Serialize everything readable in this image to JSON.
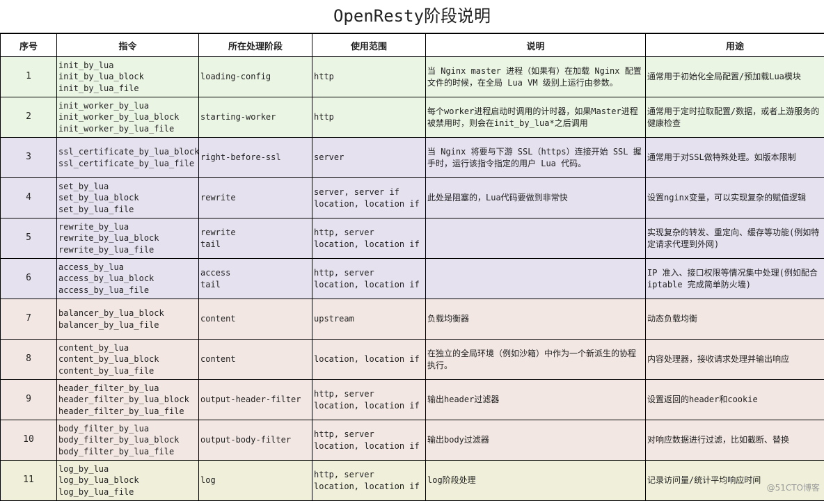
{
  "title": "OpenResty阶段说明",
  "headers": [
    "序号",
    "指令",
    "所在处理阶段",
    "使用范围",
    "说明",
    "用途"
  ],
  "rows": [
    {
      "no": "1",
      "directives": [
        "init_by_lua",
        "init_by_lua_block",
        "init_by_lua_file"
      ],
      "phase": [
        "loading-config"
      ],
      "scope": [
        "http"
      ],
      "desc": "当 Nginx master 进程（如果有）在加载 Nginx 配置文件的时候，在全局 Lua VM 级别上运行由参数。",
      "use": "通常用于初始化全局配置/预加载Lua模块"
    },
    {
      "no": "2",
      "directives": [
        "init_worker_by_lua",
        "init_worker_by_lua_block",
        "init_worker_by_lua_file"
      ],
      "phase": [
        "starting-worker"
      ],
      "scope": [
        "http"
      ],
      "desc": "每个worker进程启动时调用的计时器，如果Master进程被禁用时，则会在init_by_lua*之后调用",
      "use": "通常用于定时拉取配置/数据，或者上游服务的健康检查"
    },
    {
      "no": "3",
      "directives": [
        "ssl_certificate_by_lua_block",
        "ssl_certificate_by_lua_file"
      ],
      "phase": [
        "right-before-ssl"
      ],
      "scope": [
        "server"
      ],
      "desc": "当 Nginx 将要与下游 SSL（https）连接开始 SSL 握手时，运行该指令指定的用户 Lua 代码。",
      "use": "通常用于对SSL做特殊处理。如版本限制"
    },
    {
      "no": "4",
      "directives": [
        "set_by_lua",
        "set_by_lua_block",
        "set_by_lua_file"
      ],
      "phase": [
        "rewrite"
      ],
      "scope": [
        "server, server if",
        "location, location if"
      ],
      "desc": "此处是阻塞的，Lua代码要做到非常快",
      "use": "设置nginx变量，可以实现复杂的赋值逻辑"
    },
    {
      "no": "5",
      "directives": [
        "rewrite_by_lua",
        "rewrite_by_lua_block",
        "rewrite_by_lua_file"
      ],
      "phase": [
        "rewrite",
        "tail"
      ],
      "scope": [
        "http, server",
        "location, location if"
      ],
      "desc": "",
      "use": "实现复杂的转发、重定向、缓存等功能(例如特定请求代理到外网)"
    },
    {
      "no": "6",
      "directives": [
        "access_by_lua",
        "access_by_lua_block",
        "access_by_lua_file"
      ],
      "phase": [
        "access",
        "tail"
      ],
      "scope": [
        "http, server",
        "location, location if"
      ],
      "desc": "",
      "use": " IP 准入、接口权限等情况集中处理(例如配合 iptable 完成简单防火墙)"
    },
    {
      "no": "7",
      "directives": [
        "balancer_by_lua_block",
        "balancer_by_lua_file"
      ],
      "phase": [
        "content"
      ],
      "scope": [
        "upstream"
      ],
      "desc": "负载均衡器",
      "use": "动态负载均衡"
    },
    {
      "no": "8",
      "directives": [
        "content_by_lua",
        "content_by_lua_block",
        "content_by_lua_file"
      ],
      "phase": [
        "content"
      ],
      "scope": [
        "location, location if"
      ],
      "desc": "在独立的全局环境（例如沙箱）中作为一个新派生的协程执行。",
      "use": "内容处理器，接收请求处理并输出响应"
    },
    {
      "no": "9",
      "directives": [
        "header_filter_by_lua",
        "header_filter_by_lua_block",
        "header_filter_by_lua_file"
      ],
      "phase": [
        "output-header-filter"
      ],
      "scope": [
        "http, server",
        "location, location if"
      ],
      "desc": "输出header过滤器",
      "use": "设置返回的header和cookie"
    },
    {
      "no": "10",
      "directives": [
        "body_filter_by_lua",
        "body_filter_by_lua_block",
        "body_filter_by_lua_file"
      ],
      "phase": [
        "output-body-filter"
      ],
      "scope": [
        "http, server",
        "location, location if"
      ],
      "desc": "输出body过滤器",
      "use": "对响应数据进行过滤，比如截断、替换"
    },
    {
      "no": "11",
      "directives": [
        "log_by_lua",
        "log_by_lua_block",
        "log_by_lua_file"
      ],
      "phase": [
        "log"
      ],
      "scope": [
        "http, server",
        "location, location if"
      ],
      "desc": "log阶段处理",
      "use": "记录访问量/统计平均响应时间"
    }
  ],
  "watermark": "@51CTO博客"
}
